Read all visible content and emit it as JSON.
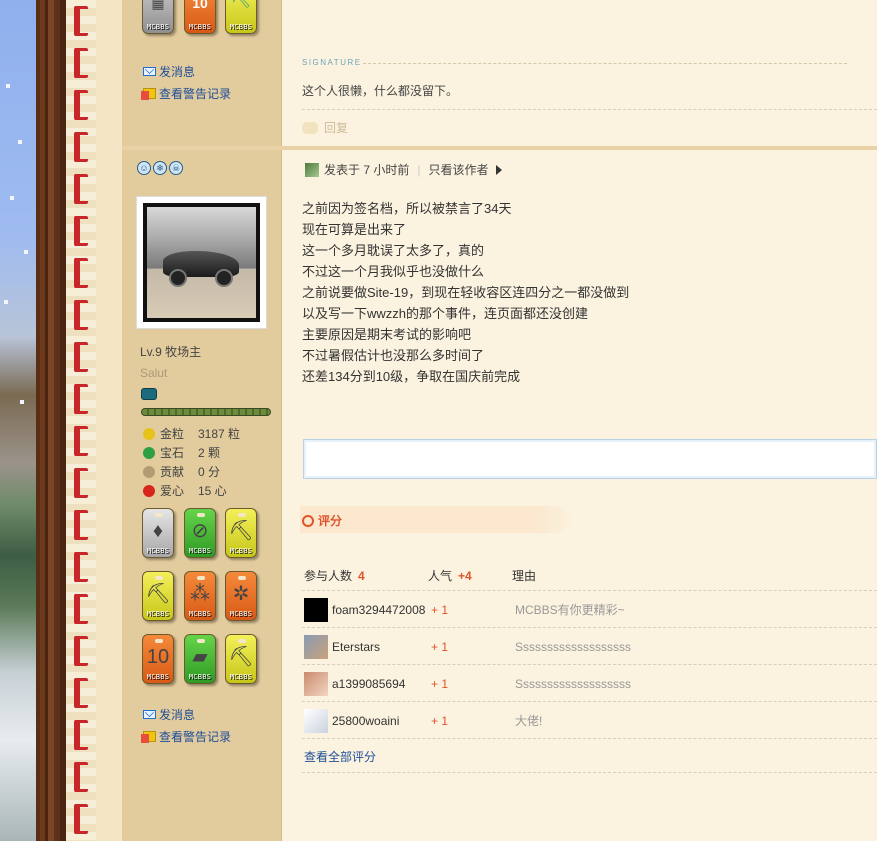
{
  "profile_top": {
    "medals": [
      {
        "icon": "gray-ore-medal",
        "text": "MCBBS"
      },
      {
        "icon": "number-10-medal",
        "text": "MCBBS"
      },
      {
        "icon": "diamond-pickaxe-medal",
        "text": "MCBBS"
      }
    ],
    "send_message": "发消息",
    "view_warnings": "查看警告记录"
  },
  "signature": {
    "label": "SIGNATURE",
    "text": "这个人很懒，什么都没留下。",
    "reply_label": "回复"
  },
  "profile": {
    "status_icons": [
      "face-icon",
      "snowflake-icon",
      "skull-icon"
    ],
    "level": "Lv.9 牧场主",
    "custom_title": "Salut",
    "stats": [
      {
        "icon": "gold-nugget-icon",
        "label": "金粒",
        "value": "3187 粒",
        "color": "#e7c21b"
      },
      {
        "icon": "emerald-icon",
        "label": "宝石",
        "value": "2 颗",
        "color": "#2ea043"
      },
      {
        "icon": "contribution-icon",
        "label": "贡献",
        "value": "0 分",
        "color": "#b49a72"
      },
      {
        "icon": "apple-icon",
        "label": "爱心",
        "value": "15 心",
        "color": "#d8261c"
      }
    ],
    "medals": [
      {
        "icon": "fire-crystal-medal",
        "text": "MCBBS",
        "style": "m-silver",
        "glyph": "♦"
      },
      {
        "icon": "no-tnt-medal",
        "text": "MCBBS",
        "style": "m-green",
        "glyph": "⊘"
      },
      {
        "icon": "pickaxe-medal",
        "text": "MCBBS",
        "style": "m-yellow",
        "glyph": "⛏"
      },
      {
        "icon": "iron-pickaxe-medal",
        "text": "MCBBS",
        "style": "m-yellow",
        "glyph": "⛏"
      },
      {
        "icon": "seeds-medal",
        "text": "MCBBS",
        "style": "m-orange",
        "glyph": "⁂"
      },
      {
        "icon": "cactus-medal",
        "text": "MCBBS",
        "style": "m-orange",
        "glyph": "✲"
      },
      {
        "icon": "number-10-medal",
        "text": "MCBBS",
        "style": "m-orange",
        "glyph": "10"
      },
      {
        "icon": "gold-ingot-medal",
        "text": "MCBBS",
        "style": "m-green",
        "glyph": "▰"
      },
      {
        "icon": "diamond-pickaxe-medal",
        "text": "MCBBS",
        "style": "m-yellow",
        "glyph": "⛏"
      }
    ],
    "send_message": "发消息",
    "view_warnings": "查看警告记录"
  },
  "post": {
    "posted_time": "发表于 7 小时前",
    "separator": "|",
    "author_only": "只看该作者",
    "body": [
      "之前因为签名档，所以被禁言了34天",
      "现在可算是出来了",
      "这一个多月耽误了太多了，真的",
      "不过这一个月我似乎也没做什么",
      "之前说要做Site-19，到现在轻收容区连四分之一都没做到",
      "以及写一下wwzzh的那个事件，连页面都还没创建",
      "主要原因是期末考试的影响吧",
      "不过暑假估计也没那么多时间了",
      "还差134分到10级，争取在国庆前完成"
    ]
  },
  "rating": {
    "title": "评分",
    "header": {
      "participants_label": "参与人数",
      "participants_count": "4",
      "popularity_label": "人气",
      "popularity_value": "+4",
      "reason_label": "理由"
    },
    "rows": [
      {
        "user": "foam3294472008",
        "score": "+ 1",
        "reason": "MCBBS有你更精彩~",
        "avatar_color": "#000000"
      },
      {
        "user": "Eterstars",
        "score": "+ 1",
        "reason": "Sssssssssssssssssss",
        "avatar_color": "#8a9bb3"
      },
      {
        "user": "a1399085694",
        "score": "+ 1",
        "reason": "Sssssssssssssssssss",
        "avatar_color": "#c98a6e"
      },
      {
        "user": "25800woaini",
        "score": "+ 1",
        "reason": "大佬!",
        "avatar_color": "#dfe3ea"
      }
    ],
    "view_all": "查看全部评分"
  }
}
